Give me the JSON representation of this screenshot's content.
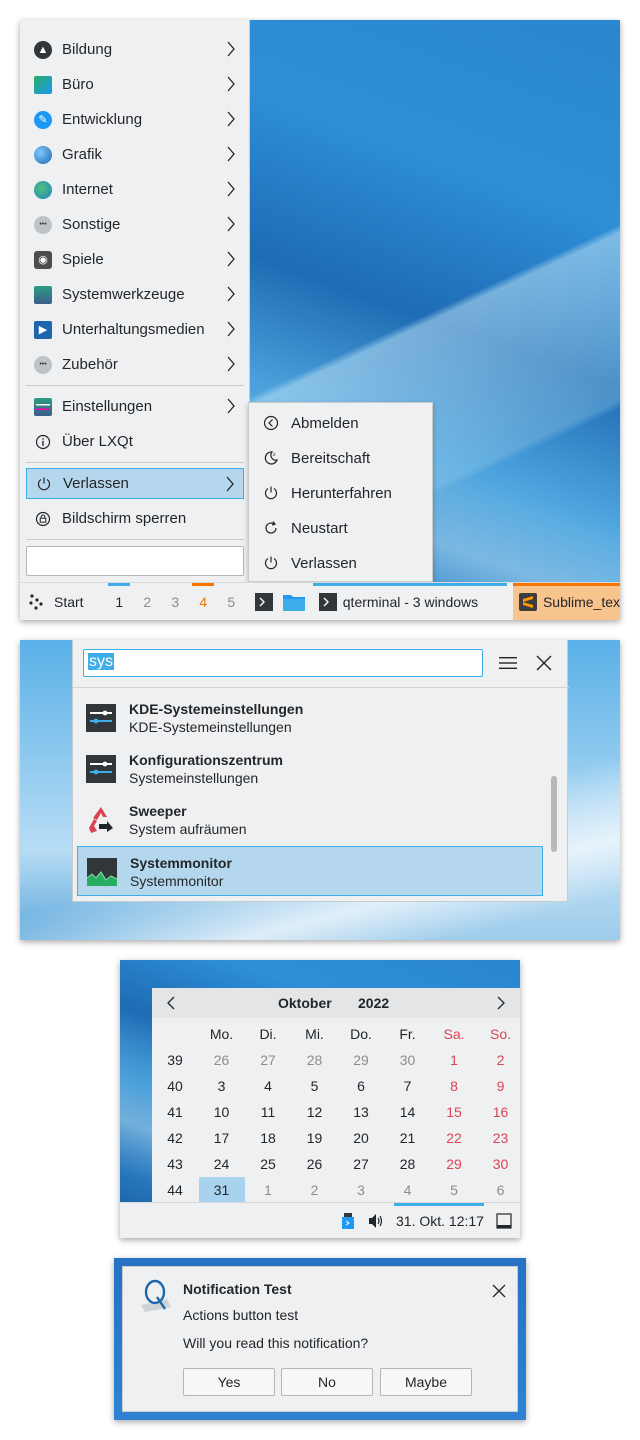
{
  "menu": {
    "items": [
      {
        "label": "Bildung",
        "icon": "education-icon"
      },
      {
        "label": "Büro",
        "icon": "office-icon"
      },
      {
        "label": "Entwicklung",
        "icon": "development-icon"
      },
      {
        "label": "Grafik",
        "icon": "graphics-icon"
      },
      {
        "label": "Internet",
        "icon": "internet-icon"
      },
      {
        "label": "Sonstige",
        "icon": "other-icon"
      },
      {
        "label": "Spiele",
        "icon": "games-icon"
      },
      {
        "label": "Systemwerkzeuge",
        "icon": "system-tools-icon"
      },
      {
        "label": "Unterhaltungsmedien",
        "icon": "multimedia-icon"
      },
      {
        "label": "Zubehör",
        "icon": "accessories-icon"
      }
    ],
    "settings_label": "Einstellungen",
    "about_label": "Über LXQt",
    "leave_label": "Verlassen",
    "lock_label": "Bildschirm sperren",
    "search_value": ""
  },
  "leave_submenu": {
    "items": [
      {
        "label": "Abmelden",
        "icon": "logout-icon"
      },
      {
        "label": "Bereitschaft",
        "icon": "suspend-icon"
      },
      {
        "label": "Herunterfahren",
        "icon": "shutdown-icon"
      },
      {
        "label": "Neustart",
        "icon": "reboot-icon"
      },
      {
        "label": "Verlassen",
        "icon": "shutdown-icon"
      }
    ]
  },
  "taskbar": {
    "start_label": "Start",
    "desktops": [
      "1",
      "2",
      "3",
      "4",
      "5"
    ],
    "current_desktop": "1",
    "urgent_desktop": "4",
    "tasks": [
      {
        "label": "qterminal - 3 windows"
      },
      {
        "label": "Sublime_text"
      }
    ]
  },
  "runner": {
    "query": "sys",
    "results": [
      {
        "title": "KDE-Systemeinstellungen",
        "subtitle": "KDE-Systemeinstellungen"
      },
      {
        "title": "Konfigurationszentrum",
        "subtitle": "Systemeinstellungen"
      },
      {
        "title": "Sweeper",
        "subtitle": "System aufräumen"
      },
      {
        "title": "Systemmonitor",
        "subtitle": "Systemmonitor"
      }
    ]
  },
  "calendar": {
    "month": "Oktober",
    "year": "2022",
    "weekdays": [
      "Mo.",
      "Di.",
      "Mi.",
      "Do.",
      "Fr.",
      "Sa.",
      "So."
    ],
    "weeks": [
      {
        "week": "39",
        "days": [
          "26",
          "27",
          "28",
          "29",
          "30",
          "1",
          "2"
        ]
      },
      {
        "week": "40",
        "days": [
          "3",
          "4",
          "5",
          "6",
          "7",
          "8",
          "9"
        ]
      },
      {
        "week": "41",
        "days": [
          "10",
          "11",
          "12",
          "13",
          "14",
          "15",
          "16"
        ]
      },
      {
        "week": "42",
        "days": [
          "17",
          "18",
          "19",
          "20",
          "21",
          "22",
          "23"
        ]
      },
      {
        "week": "43",
        "days": [
          "24",
          "25",
          "26",
          "27",
          "28",
          "29",
          "30"
        ]
      },
      {
        "week": "44",
        "days": [
          "31",
          "1",
          "2",
          "3",
          "4",
          "5",
          "6"
        ]
      }
    ],
    "today": "31",
    "clock": "31. Okt. 12:17"
  },
  "notification": {
    "title": "Notification Test",
    "body_line1": "Actions button test",
    "body_line2": "Will you read this notification?",
    "buttons": [
      "Yes",
      "No",
      "Maybe"
    ]
  },
  "colors": {
    "accent": "#3daee9",
    "weekend": "#da4453",
    "urgent": "#f67400",
    "panel_bg": "#eff0f1"
  }
}
